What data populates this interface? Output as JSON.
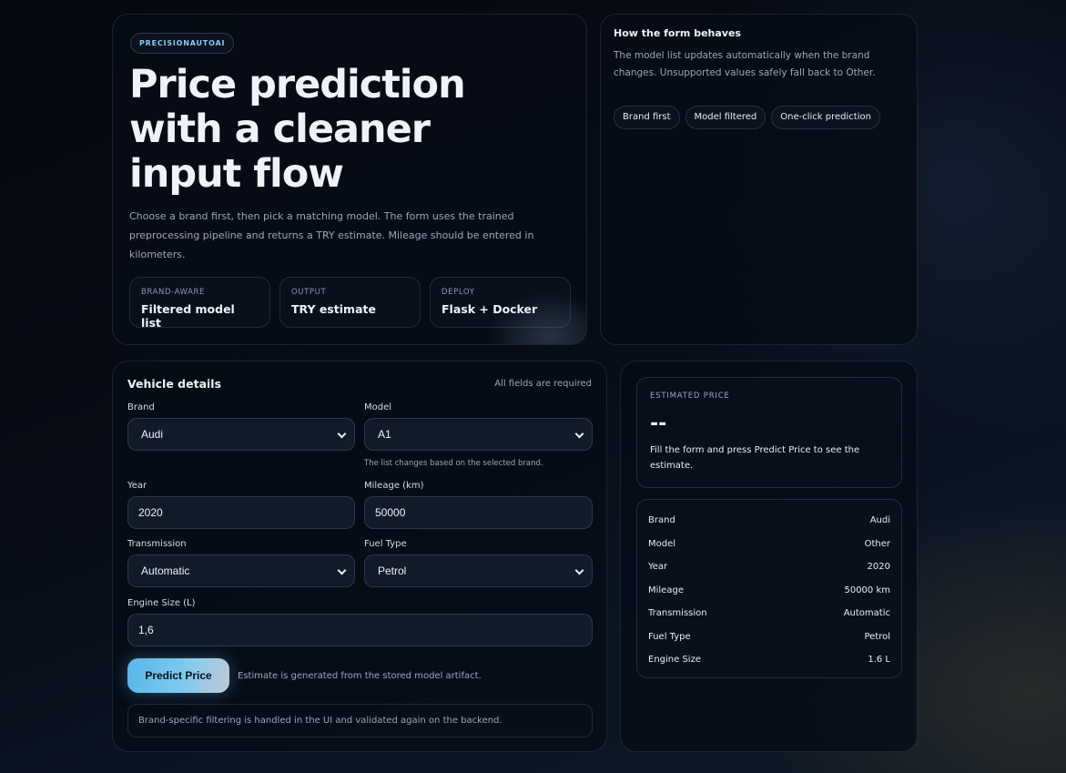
{
  "hero": {
    "badge": "PRECISIONAUTOAI",
    "title": "Price prediction with a cleaner input flow",
    "description": "Choose a brand first, then pick a matching model. The form uses the trained preprocessing pipeline and returns a TRY estimate. Mileage should be entered in kilometers.",
    "stats": [
      {
        "key": "BRAND-AWARE",
        "value": "Filtered model list"
      },
      {
        "key": "OUTPUT",
        "value": "TRY estimate"
      },
      {
        "key": "DEPLOY",
        "value": "Flask + Docker"
      }
    ]
  },
  "how": {
    "title": "How the form behaves",
    "description": "The model list updates automatically when the brand changes. Unsupported values safely fall back to Other.",
    "chips": [
      "Brand first",
      "Model filtered",
      "One-click prediction"
    ]
  },
  "form": {
    "title": "Vehicle details",
    "required_note": "All fields are required",
    "brand": {
      "label": "Brand",
      "value": "Audi"
    },
    "model": {
      "label": "Model",
      "value": "A1",
      "hint": "The list changes based on the selected brand."
    },
    "year": {
      "label": "Year",
      "value": "2020"
    },
    "mileage": {
      "label": "Mileage (km)",
      "value": "50000"
    },
    "transmission": {
      "label": "Transmission",
      "value": "Automatic"
    },
    "fuel": {
      "label": "Fuel Type",
      "value": "Petrol"
    },
    "engine": {
      "label": "Engine Size (L)",
      "value": "1,6"
    },
    "predict_label": "Predict Price",
    "predict_note": "Estimate is generated from the stored model artifact.",
    "footer_note": "Brand-specific filtering is handled in the UI and validated again on the backend."
  },
  "result": {
    "estimate_label": "ESTIMATED PRICE",
    "estimate_value": "--",
    "estimate_desc": "Fill the form and press Predict Price to see the estimate.",
    "summary": [
      {
        "key": "Brand",
        "value": "Audi"
      },
      {
        "key": "Model",
        "value": "Other"
      },
      {
        "key": "Year",
        "value": "2020"
      },
      {
        "key": "Mileage",
        "value": "50000 km"
      },
      {
        "key": "Transmission",
        "value": "Automatic"
      },
      {
        "key": "Fuel Type",
        "value": "Petrol"
      },
      {
        "key": "Engine Size",
        "value": "1.6 L"
      }
    ]
  }
}
